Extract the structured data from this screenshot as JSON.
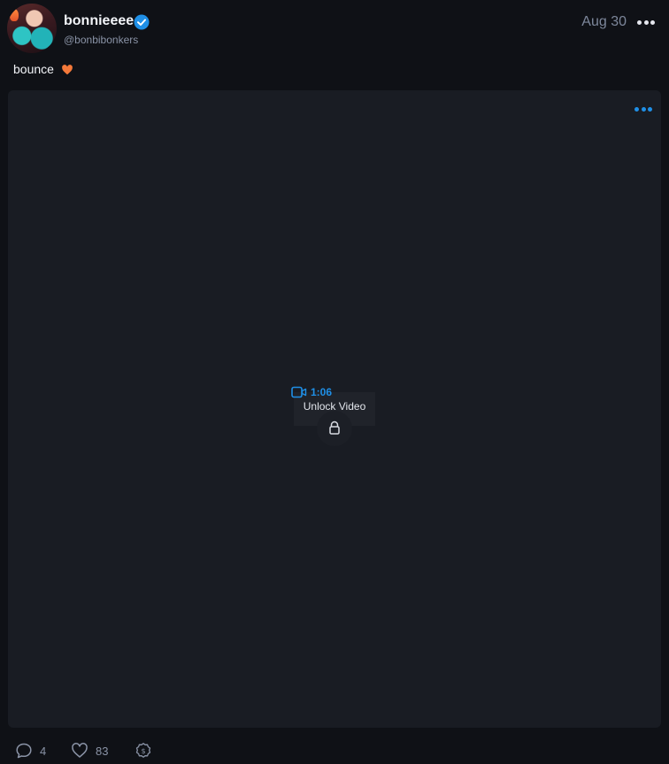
{
  "post": {
    "display_name": "bonnieeee",
    "handle": "@bonbibonkers",
    "date": "Aug 30",
    "caption": "bounce"
  },
  "media": {
    "duration": "1:06",
    "unlock_label": "Unlock Video"
  },
  "actions": {
    "comments": "4",
    "likes": "83"
  },
  "icons": {
    "verified": "verified-badge-icon",
    "more": "more-dots-icon",
    "video": "video-camera-icon",
    "lock": "lock-icon",
    "comment": "comment-bubble-icon",
    "like": "heart-icon",
    "tip": "dollar-tip-icon",
    "emoji": "orange-heart-emoji"
  },
  "colors": {
    "background": "#0f1116",
    "media_bg": "#191c23",
    "accent": "#1f8fe6",
    "muted": "#8a93a6"
  }
}
